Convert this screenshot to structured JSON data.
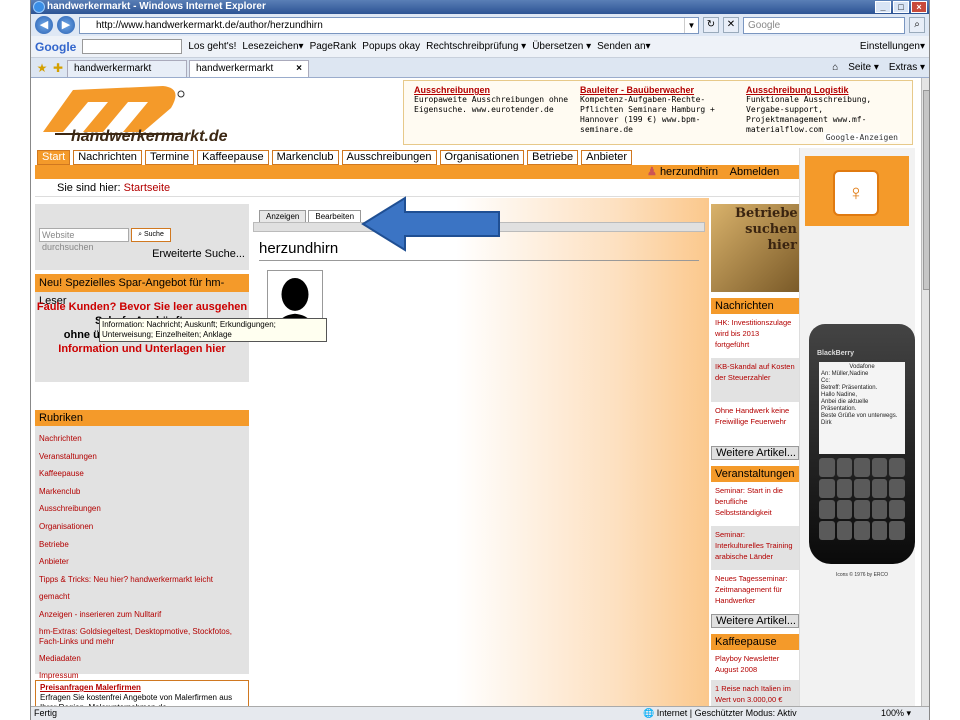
{
  "window": {
    "title": "handwerkermarkt - Windows Internet Explorer"
  },
  "address": {
    "url": "http://www.handwerkermarkt.de/author/herzundhirn",
    "search_placeholder": "Google"
  },
  "google_toolbar": {
    "logo": "Google",
    "items": [
      "Los geht's!",
      "Lesezeichen▾",
      "PageRank",
      "Popups okay",
      "Rechtschreibprüfung ▾",
      "Übersetzen ▾",
      "Senden an▾"
    ],
    "settings": "Einstellungen▾"
  },
  "tabs": [
    {
      "label": "handwerkermarkt"
    },
    {
      "label": "handwerkermarkt"
    }
  ],
  "tab_tools": {
    "page": "Seite ▾",
    "extras": "Extras ▾"
  },
  "site": {
    "logo_text": "handwerkermarkt.de",
    "ads": [
      {
        "title": "Ausschreibungen",
        "text": "Europaweite Ausschreibungen ohne Eigensuche. www.eurotender.de"
      },
      {
        "title": "Bauleiter - Bauüberwacher",
        "text": "Kompetenz-Aufgaben-Rechte-Pflichten Seminare Hamburg + Hannover (199 €) www.bpm-seminare.de"
      },
      {
        "title": "Ausschreibung Logistik",
        "text": "Funktionale Ausschreibung, Vergabe-support, Projektmanagement www.mf-materialflow.com"
      }
    ],
    "ads_label": "Google-Anzeigen",
    "nav": [
      "Start",
      "Nachrichten",
      "Termine",
      "Kaffeepause",
      "Markenclub",
      "Ausschreibungen",
      "Organisationen",
      "Betriebe",
      "Anbieter"
    ],
    "user": {
      "name": "herzundhirn",
      "logout": "Abmelden"
    },
    "breadcrumb": {
      "prefix": "Sie sind hier:",
      "link": "Startseite"
    }
  },
  "sidebar": {
    "search_placeholder": "Website durchsuchen",
    "search_button": "Suche",
    "advanced": "Erweiterte Suche...",
    "promo_header": "Neu! Spezielles Spar-Angebot für hm-Leser",
    "promo_lines": [
      "Faule Kunden? Bevor Sie leer ausgehen",
      "Schufa-Auskünfte",
      "ohne übliche Mindestumsätze",
      "Information und Unterlagen hier"
    ],
    "tooltip": "Information: Nachricht; Auskunft; Erkundigungen; Unterweisung; Einzelheiten; Anklage",
    "rubriken_header": "Rubriken",
    "rubriken": [
      "Nachrichten",
      "Veranstaltungen",
      "Kaffeepause",
      "Markenclub",
      "Ausschreibungen",
      "Organisationen",
      "Betriebe",
      "Anbieter",
      "Tipps & Tricks: Neu hier? handwerkermarkt leicht gemacht",
      "Anzeigen - inserieren zum Nulltarif",
      "hm-Extras: Goldsiegeltest, Desktopmotive, Stockfotos, Fach-Links und mehr",
      "Mediadaten",
      "Impressum"
    ],
    "preis": {
      "title": "Preisanfragen Malerfirmen",
      "text": "Erfragen Sie kostenfrei Angebote von Malerfirmen aus Ihrer Region. Malerunternehmen.de"
    }
  },
  "profile": {
    "tabs": [
      "Anzeigen",
      "Bearbeiten"
    ],
    "title": "herzundhirn"
  },
  "rightcol": {
    "promo_text": "Betriebe suchen hier",
    "nachrichten_header": "Nachrichten",
    "nachrichten": [
      "IHK: Investitionszulage wird bis 2013 fortgeführt",
      "IKB-Skandal auf Kosten der Steuerzahler",
      "Ohne Handwerk keine Freiwillige Feuerwehr"
    ],
    "more": "Weitere Artikel...",
    "veranst_header": "Veranstaltungen",
    "veranst": [
      "Seminar: Start in die berufliche Selbstständigkeit",
      "Seminar: Interkulturelles Training arabische Länder",
      "Neues Tagesseminar: Zeitmanagement für Handwerker"
    ],
    "kaffee_header": "Kaffeepause",
    "kaffee": [
      "Playboy Newsletter August 2008",
      "1 Reise nach Italien im Wert von 3.000,00 €"
    ]
  },
  "phone": {
    "brand": "BlackBerry",
    "screen": [
      "Vodafone",
      "An: Müller,Nadine",
      "Cc:",
      "Betreff: Präsentation.",
      "Hallo Nadine,",
      "Anbei die aktuelle Präsentation.",
      "Beste Grüße von unterwegs.",
      "Dirk"
    ],
    "foot": "Icons © 1976 by ERCO"
  },
  "status": {
    "left": "Fertig",
    "zone": "Internet | Geschützter Modus: Aktiv",
    "zoom": "100% ▾"
  },
  "colors": {
    "accent": "#f49a2a",
    "link": "#b30000",
    "arrow": "#3b74c4"
  }
}
